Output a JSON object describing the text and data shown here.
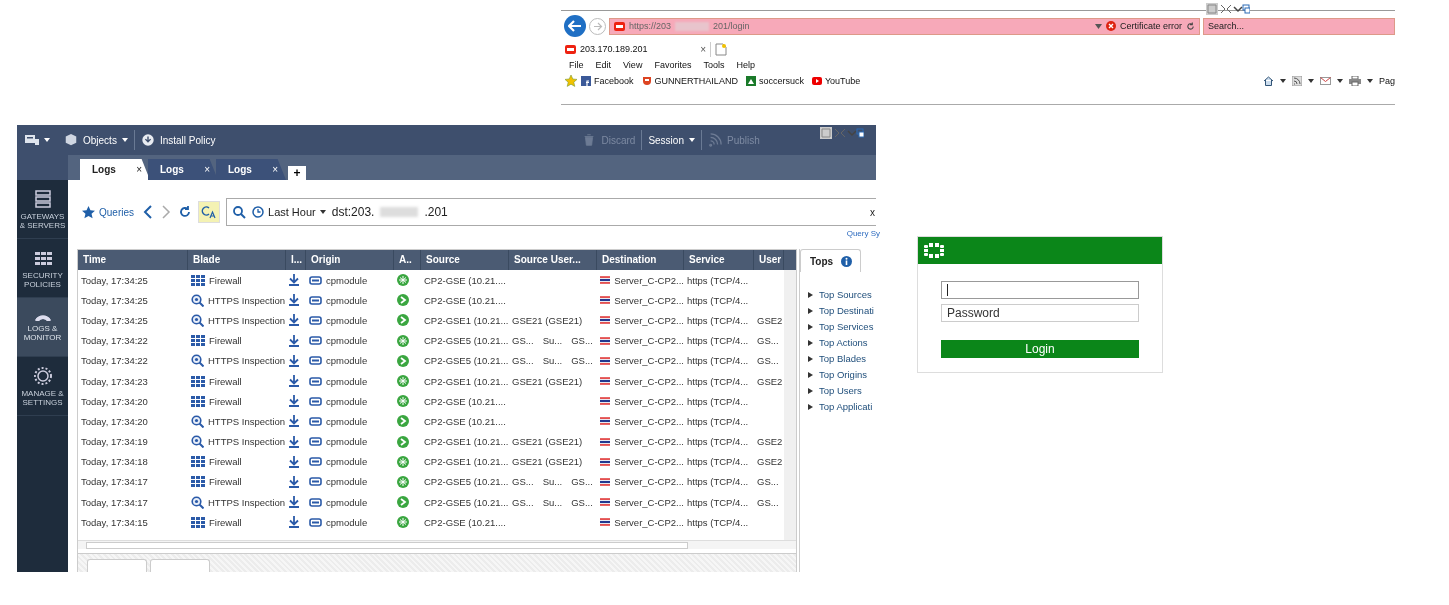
{
  "browser": {
    "url_start": "https://203",
    "url_end": "201/login",
    "certificate_error": "Certificate error",
    "search": {
      "placeholder": "Search..."
    },
    "tab": {
      "title": "203.170.189.201",
      "close": "×"
    },
    "menu": [
      "File",
      "Edit",
      "View",
      "Favorites",
      "Tools",
      "Help"
    ],
    "favorites": [
      "Facebook",
      "GUNNERTHAILAND",
      "soccersuck",
      "YouTube"
    ],
    "page_menu": "Pag"
  },
  "app": {
    "toolbar": [
      {
        "label": "Objects",
        "dropdown": true,
        "disabled": false
      },
      {
        "label": "Install Policy",
        "dropdown": false,
        "disabled": false
      },
      {
        "label": "Discard",
        "dropdown": false,
        "disabled": true
      },
      {
        "label": "Session",
        "dropdown": true,
        "disabled": false
      },
      {
        "label": "Publish",
        "dropdown": false,
        "disabled": true
      }
    ],
    "tabs": [
      {
        "label": "Logs",
        "selected": true,
        "close": "×"
      },
      {
        "label": "Logs",
        "selected": false,
        "close": "×"
      },
      {
        "label": "Logs",
        "selected": false,
        "close": "×"
      }
    ],
    "new_tab": "+",
    "sidebar": [
      {
        "label": "GATEWAYS & SERVERS",
        "selected": false
      },
      {
        "label": "SECURITY POLICIES",
        "selected": false
      },
      {
        "label": "LOGS & MONITOR",
        "selected": true
      },
      {
        "label": "MANAGE & SETTINGS",
        "selected": false
      }
    ],
    "query": {
      "queries": "Queries",
      "time_range": "Last Hour",
      "filter_start": "dst:203.",
      "filter_end": ".201",
      "clear": "x",
      "syntax_link": "Query Sy"
    },
    "table": {
      "columns": [
        "Time",
        "Blade",
        "I...",
        "Origin",
        "A..",
        "Source",
        "Source User...",
        "Destination",
        "Service",
        "User"
      ],
      "rows": [
        {
          "time": "Today, 17:34:25",
          "blade": "Firewall",
          "kind": "firewall",
          "origin": "cpmodule",
          "source": "CP2-GSE (10.21....",
          "source_user": [],
          "destination": "Server_C-CP2...",
          "service": "https (TCP/4..."
        },
        {
          "time": "Today, 17:34:25",
          "blade": "HTTPS Inspection",
          "kind": "https",
          "origin": "cpmodule",
          "source": "CP2-GSE (10.21....",
          "source_user": [],
          "destination": "Server_C-CP2...",
          "service": "https (TCP/4..."
        },
        {
          "time": "Today, 17:34:25",
          "blade": "HTTPS Inspection",
          "kind": "https",
          "origin": "cpmodule",
          "source": "CP2-GSE1 (10.21...",
          "source_user": [
            "GSE21 (GSE21)"
          ],
          "destination": "Server_C-CP2...",
          "service": "https (TCP/4...",
          "user": "GSE2"
        },
        {
          "time": "Today, 17:34:22",
          "blade": "Firewall",
          "kind": "firewall",
          "origin": "cpmodule",
          "source": "CP2-GSE5 (10.21...",
          "source_user": [
            "GS...",
            "Su...",
            "GS..."
          ],
          "destination": "Server_C-CP2...",
          "service": "https (TCP/4...",
          "user": "GS..."
        },
        {
          "time": "Today, 17:34:22",
          "blade": "HTTPS Inspection",
          "kind": "https",
          "origin": "cpmodule",
          "source": "CP2-GSE5 (10.21...",
          "source_user": [
            "GS...",
            "Su...",
            "GS..."
          ],
          "destination": "Server_C-CP2...",
          "service": "https (TCP/4...",
          "user": "GS..."
        },
        {
          "time": "Today, 17:34:23",
          "blade": "Firewall",
          "kind": "firewall",
          "origin": "cpmodule",
          "source": "CP2-GSE1 (10.21...",
          "source_user": [
            "GSE21 (GSE21)"
          ],
          "destination": "Server_C-CP2...",
          "service": "https (TCP/4...",
          "user": "GSE2"
        },
        {
          "time": "Today, 17:34:20",
          "blade": "Firewall",
          "kind": "firewall",
          "origin": "cpmodule",
          "source": "CP2-GSE (10.21....",
          "source_user": [],
          "destination": "Server_C-CP2...",
          "service": "https (TCP/4..."
        },
        {
          "time": "Today, 17:34:20",
          "blade": "HTTPS Inspection",
          "kind": "https",
          "origin": "cpmodule",
          "source": "CP2-GSE (10.21....",
          "source_user": [],
          "destination": "Server_C-CP2...",
          "service": "https (TCP/4..."
        },
        {
          "time": "Today, 17:34:19",
          "blade": "HTTPS Inspection",
          "kind": "https",
          "origin": "cpmodule",
          "source": "CP2-GSE1 (10.21...",
          "source_user": [
            "GSE21 (GSE21)"
          ],
          "destination": "Server_C-CP2...",
          "service": "https (TCP/4...",
          "user": "GSE2"
        },
        {
          "time": "Today, 17:34:18",
          "blade": "Firewall",
          "kind": "firewall",
          "origin": "cpmodule",
          "source": "CP2-GSE1 (10.21...",
          "source_user": [
            "GSE21 (GSE21)"
          ],
          "destination": "Server_C-CP2...",
          "service": "https (TCP/4...",
          "user": "GSE2"
        },
        {
          "time": "Today, 17:34:17",
          "blade": "Firewall",
          "kind": "firewall",
          "origin": "cpmodule",
          "source": "CP2-GSE5 (10.21...",
          "source_user": [
            "GS...",
            "Su...",
            "GS..."
          ],
          "destination": "Server_C-CP2...",
          "service": "https (TCP/4...",
          "user": "GS..."
        },
        {
          "time": "Today, 17:34:17",
          "blade": "HTTPS Inspection",
          "kind": "https",
          "origin": "cpmodule",
          "source": "CP2-GSE5 (10.21...",
          "source_user": [
            "GS...",
            "Su...",
            "GS..."
          ],
          "destination": "Server_C-CP2...",
          "service": "https (TCP/4...",
          "user": "GS..."
        },
        {
          "time": "Today, 17:34:15",
          "blade": "Firewall",
          "kind": "firewall",
          "origin": "cpmodule",
          "source": "CP2-GSE (10.21....",
          "source_user": [],
          "destination": "Server_C-CP2...",
          "service": "https (TCP/4..."
        }
      ]
    },
    "tops": {
      "title": "Tops",
      "items": [
        "Top Sources",
        "Top Destinati",
        "Top Services",
        "Top Actions",
        "Top Blades",
        "Top Origins",
        "Top Users",
        "Top Applicati"
      ]
    }
  },
  "login": {
    "password": {
      "placeholder": "Password"
    },
    "button": "Login"
  }
}
